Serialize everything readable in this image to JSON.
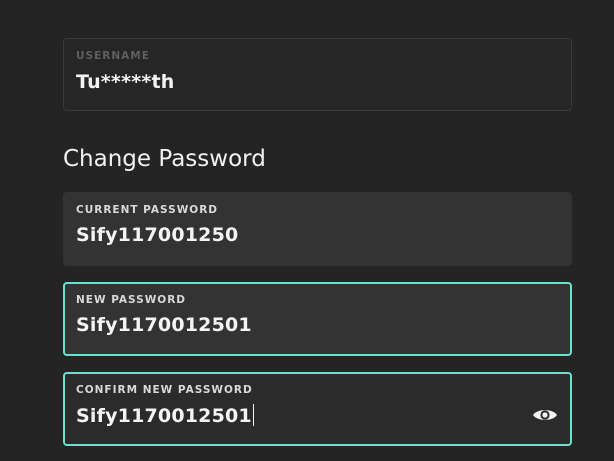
{
  "username_field": {
    "label": "USERNAME",
    "value": "Tu*****th"
  },
  "section": {
    "title": "Change Password"
  },
  "current_password": {
    "label": "CURRENT PASSWORD",
    "value": "Sify117001250"
  },
  "new_password": {
    "label": "NEW PASSWORD",
    "value": "Sify1170012501"
  },
  "confirm_password": {
    "label": "CONFIRM NEW PASSWORD",
    "value": "Sify1170012501",
    "visibility_icon": "eye-icon"
  },
  "colors": {
    "background": "#242424",
    "field_background": "#333333",
    "focus_border": "#6be0cc",
    "text": "#f2f2f2"
  }
}
